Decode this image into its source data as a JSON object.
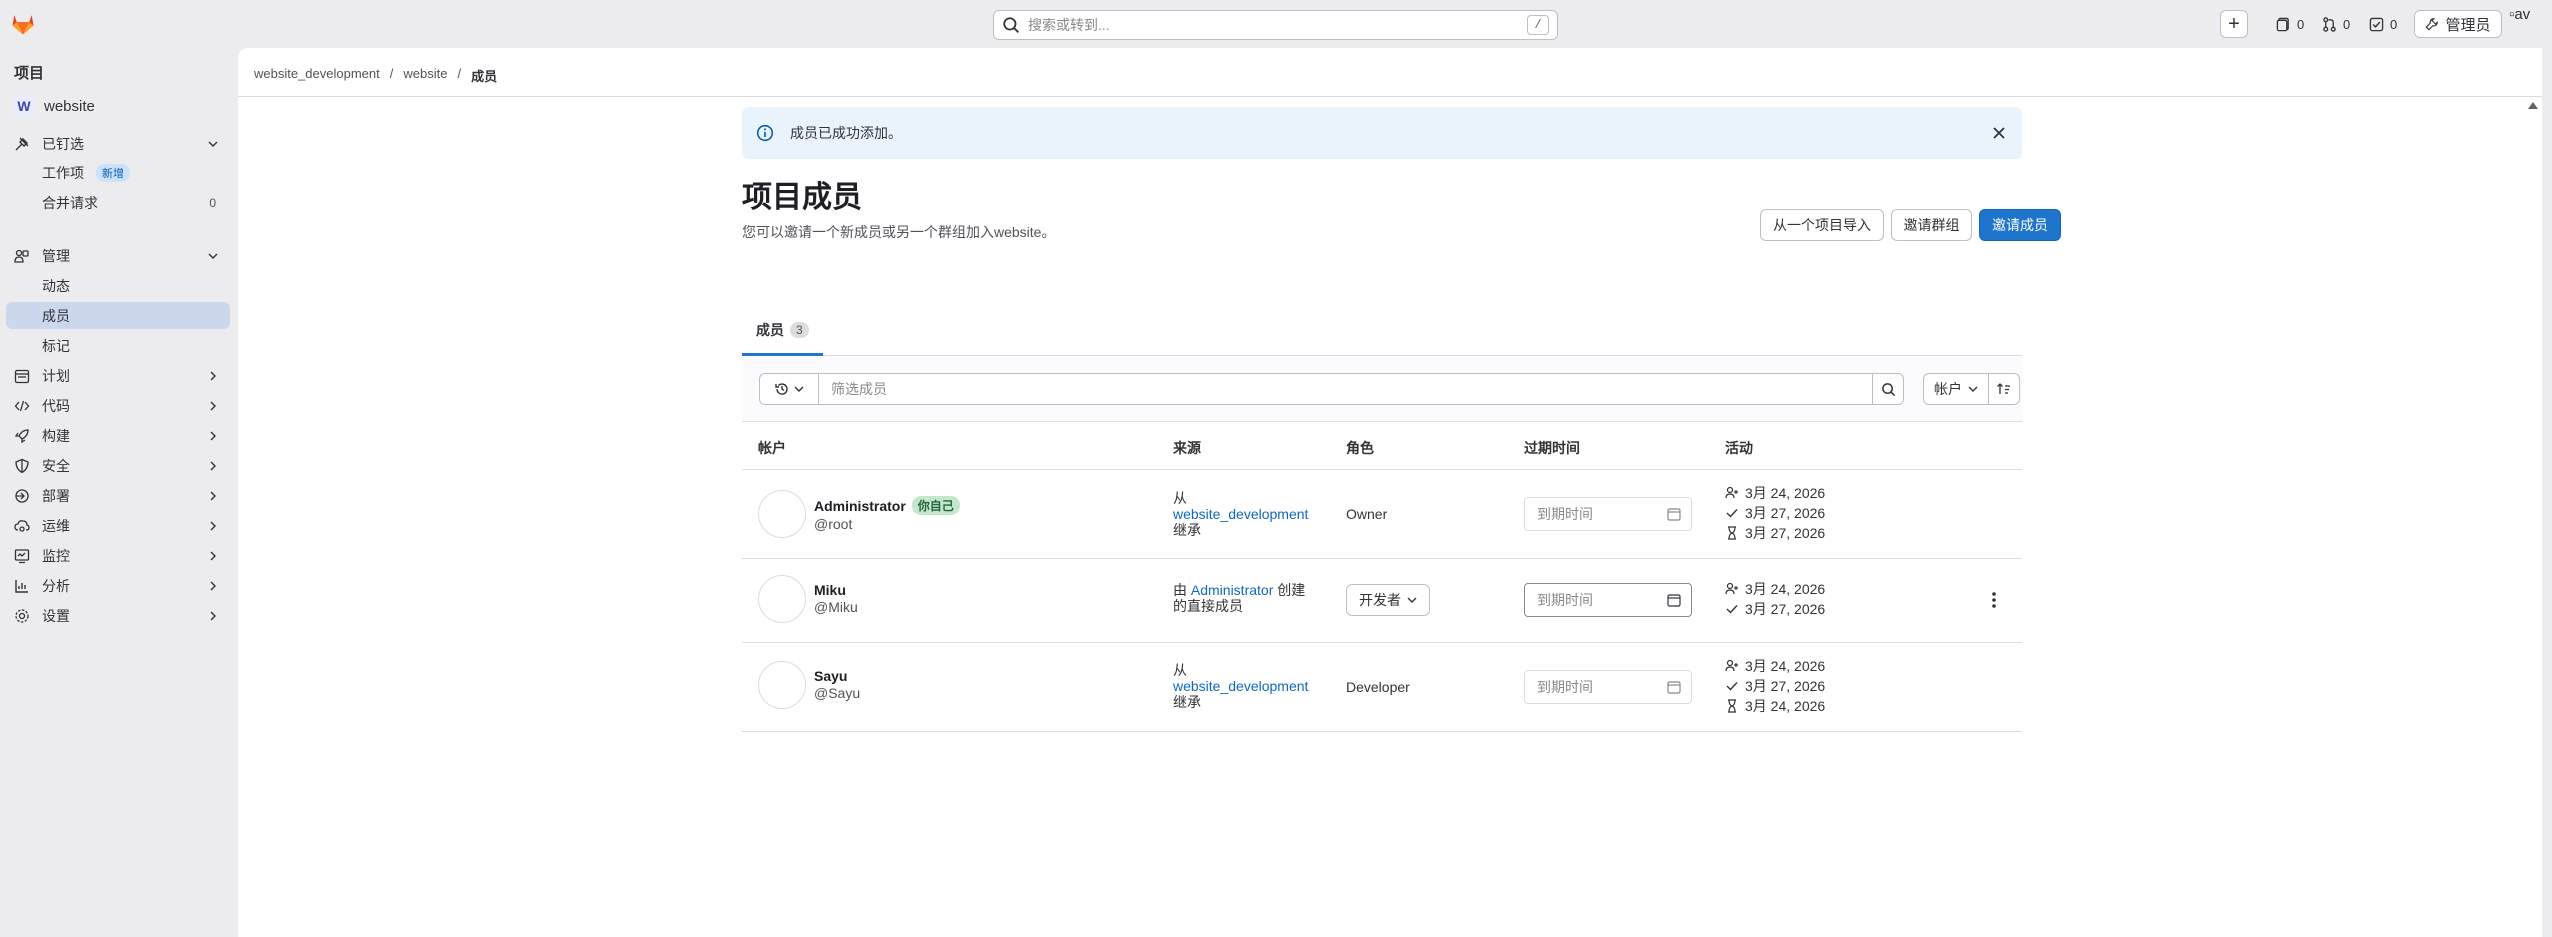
{
  "topbar": {
    "search_placeholder": "搜索或转到...",
    "search_shortcut": "/",
    "issues_count": "0",
    "merge_requests_count": "0",
    "todos_count": "0",
    "admin_label": "管理员",
    "avatar_alt": "av"
  },
  "sidebar": {
    "heading": "项目",
    "project_initial": "W",
    "project_name": "website",
    "pinned": "已钉选",
    "work_items": "工作项",
    "new_badge": "新增",
    "merge_requests": "合并请求",
    "merge_requests_count": "0",
    "manage": "管理",
    "activity": "动态",
    "members": "成员",
    "labels": "标记",
    "plan": "计划",
    "code": "代码",
    "build": "构建",
    "secure": "安全",
    "deploy": "部署",
    "operate": "运维",
    "monitor": "监控",
    "analyze": "分析",
    "settings": "设置"
  },
  "breadcrumb": [
    "website_development",
    "website",
    "成员"
  ],
  "alert": {
    "message": "成员已成功添加。"
  },
  "page": {
    "title": "项目成员",
    "description": "您可以邀请一个新成员或另一个群组加入website。",
    "import_button": "从一个项目导入",
    "invite_group_button": "邀请群组",
    "invite_member_button": "邀请成员"
  },
  "tabs": [
    {
      "label": "成员",
      "count": "3"
    }
  ],
  "filter": {
    "placeholder": "筛选成员",
    "sort_label": "帐户"
  },
  "table": {
    "headers": [
      "帐户",
      "来源",
      "角色",
      "过期时间",
      "活动"
    ],
    "rows": [
      {
        "name": "Administrator",
        "badge": "你自己",
        "handle": "@root",
        "source_prefix": "从",
        "source_link": "website_development",
        "source_suffix": "继承",
        "role": "Owner",
        "expiry_placeholder": "到期时间",
        "created": "3月 24, 2026",
        "access_granted": "3月 27, 2026",
        "last_activity": "3月 27, 2026"
      },
      {
        "name": "Miku",
        "handle": "@Miku",
        "source_prefix": "由",
        "source_link": "Administrator",
        "source_suffix": "创建",
        "source_line2": "的直接成员",
        "role": "开发者",
        "expiry_placeholder": "到期时间",
        "created": "3月 24, 2026",
        "access_granted": "3月 27, 2026"
      },
      {
        "name": "Sayu",
        "handle": "@Sayu",
        "source_prefix": "从",
        "source_link": "website_development",
        "source_suffix": "继承",
        "role": "Developer",
        "expiry_placeholder": "到期时间",
        "created": "3月 24, 2026",
        "access_granted": "3月 27, 2026",
        "last_activity": "3月 24, 2026"
      }
    ]
  },
  "colors": {
    "primary": "#1f75cb",
    "sidebar_bg": "#ececef",
    "active_item": "#cbd8ec",
    "alert_bg": "#e9f3fc",
    "self_badge": "#c3e6cd",
    "link": "#1068bf"
  }
}
